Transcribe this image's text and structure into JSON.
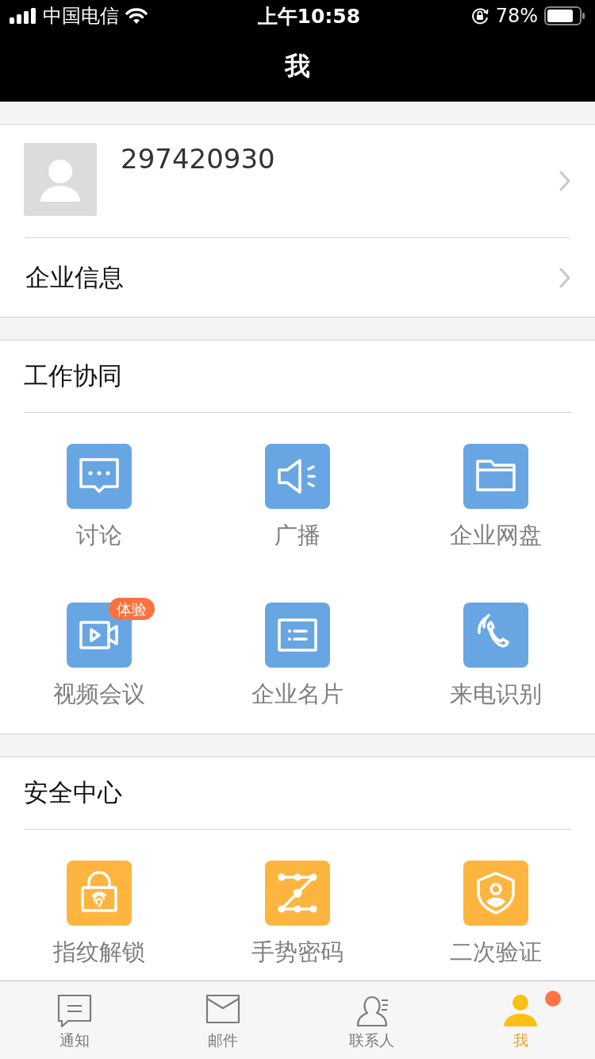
{
  "status_bar": {
    "carrier": "中国电信",
    "time": "上午10:58",
    "battery": "78%"
  },
  "nav_bar": {
    "title": "我"
  },
  "profile": {
    "account": "297420930"
  },
  "menu_rows": [
    {
      "label": "企业信息"
    }
  ],
  "sections": [
    {
      "title": "工作协同",
      "color": "#68a6e3",
      "items": [
        {
          "kind": "chat",
          "label": "讨论"
        },
        {
          "kind": "speaker",
          "label": "广播"
        },
        {
          "kind": "folder",
          "label": "企业网盘"
        },
        {
          "kind": "video",
          "label": "视频会议",
          "badge": "体验"
        },
        {
          "kind": "card",
          "label": "企业名片"
        },
        {
          "kind": "phone",
          "label": "来电识别"
        }
      ]
    },
    {
      "title": "安全中心",
      "color": "#feb540",
      "items": [
        {
          "kind": "lock",
          "label": "指纹解锁"
        },
        {
          "kind": "pattern",
          "label": "手势密码"
        },
        {
          "kind": "shield",
          "label": "二次验证"
        }
      ]
    }
  ],
  "tab_bar": {
    "tabs": [
      {
        "kind": "chat",
        "label": "通知",
        "selected": false,
        "unread": false
      },
      {
        "kind": "mail",
        "label": "邮件",
        "selected": false,
        "unread": false
      },
      {
        "kind": "contacts",
        "label": "联系人",
        "selected": false,
        "unread": false
      },
      {
        "kind": "me",
        "label": "我",
        "selected": true,
        "unread": true
      }
    ]
  }
}
